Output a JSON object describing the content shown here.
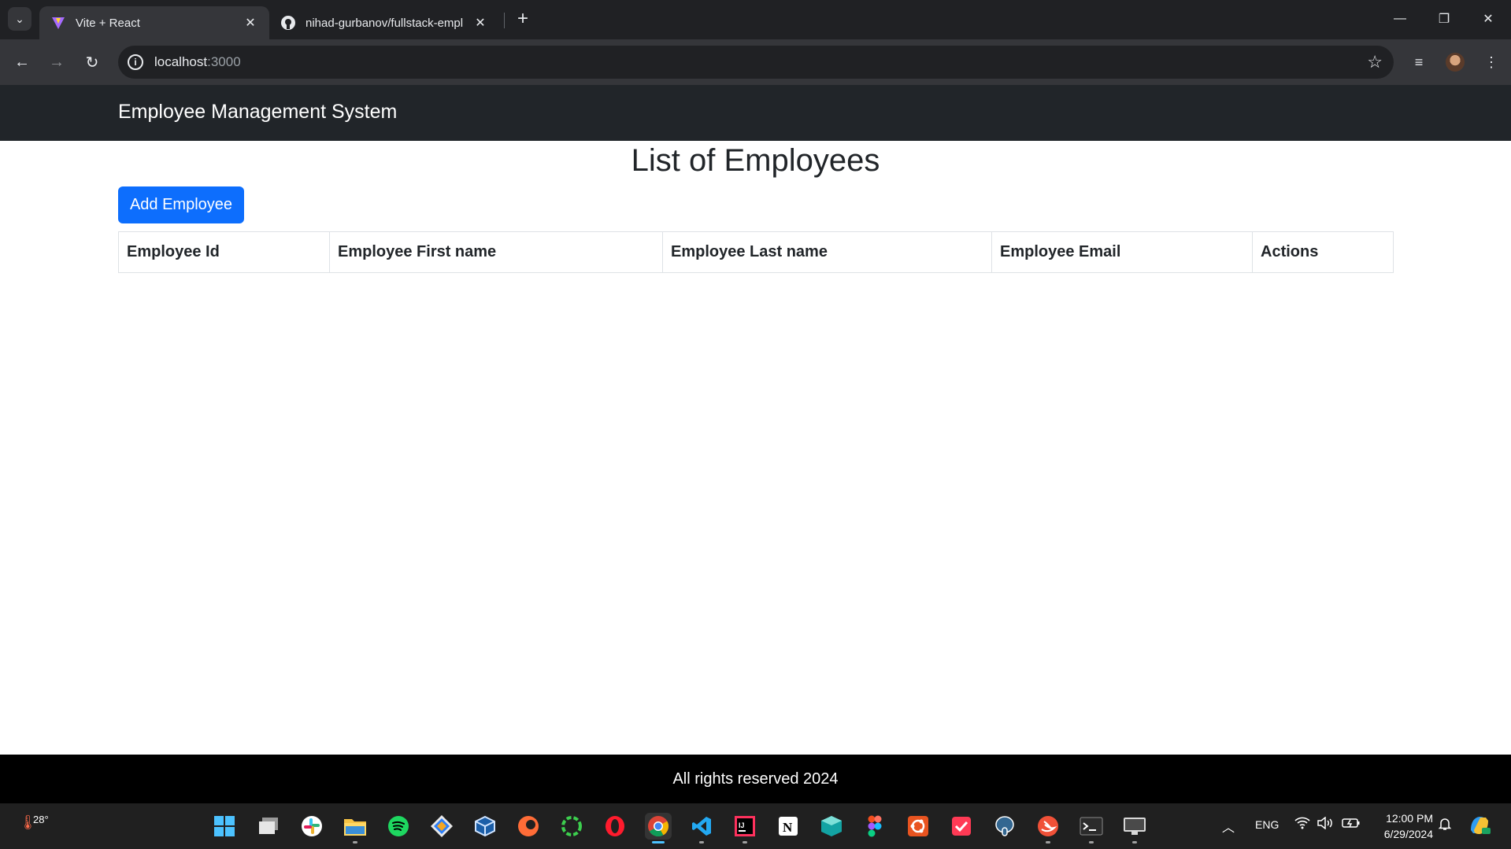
{
  "browser": {
    "tabs": [
      {
        "title": "Vite + React",
        "active": true,
        "icon": "vite-icon"
      },
      {
        "title": "nihad-gurbanov/fullstack-empl",
        "active": false,
        "icon": "github-icon"
      }
    ],
    "url_host": "localhost",
    "url_port": ":3000"
  },
  "app": {
    "brand": "Employee Management System",
    "title": "List of Employees",
    "add_button": "Add Employee",
    "table_headers": [
      "Employee Id",
      "Employee First name",
      "Employee Last name",
      "Employee Email",
      "Actions"
    ],
    "footer": "All rights reserved 2024"
  },
  "taskbar": {
    "weather_temp": "28°",
    "language": "ENG",
    "time": "12:00 PM",
    "date": "6/29/2024"
  },
  "colors": {
    "navbar_bg": "#212529",
    "primary_button": "#0d6efd",
    "footer_bg": "#000000"
  }
}
